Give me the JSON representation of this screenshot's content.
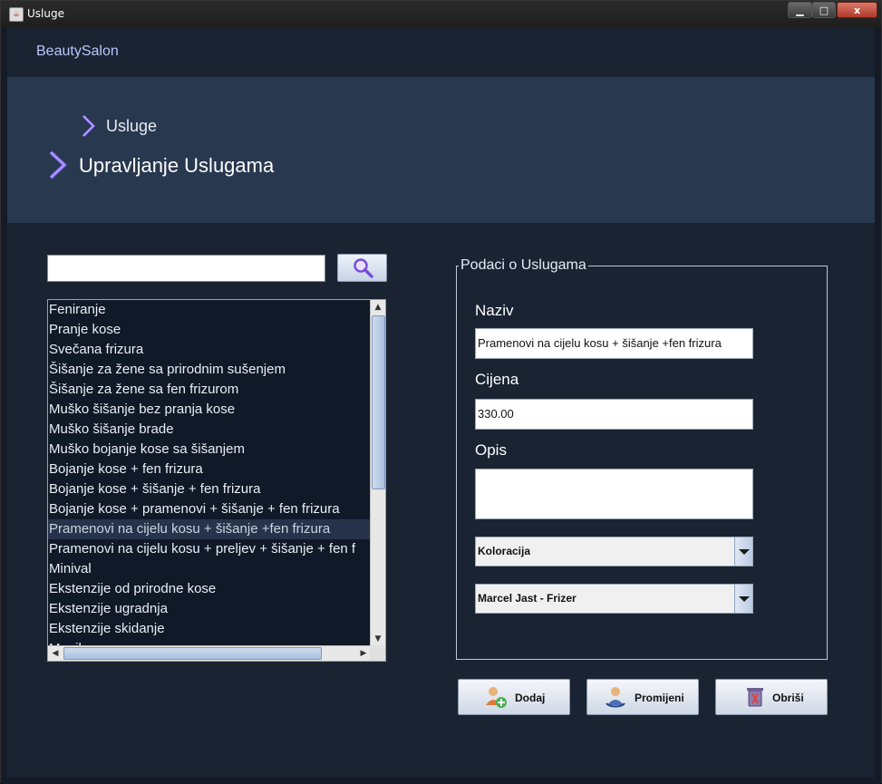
{
  "window": {
    "title": "Usluge",
    "controls": {
      "minimize": "▁",
      "maximize": "□",
      "close": "x"
    }
  },
  "header": {
    "brand": "BeautySalon"
  },
  "banner": {
    "breadcrumb": "Usluge",
    "heading": "Upravljanje Uslugama"
  },
  "search": {
    "value": "",
    "button_icon": "magnifier-icon"
  },
  "services": {
    "items": [
      "Feniranje",
      "Pranje kose",
      "Svečana frizura",
      "Šišanje za žene sa prirodnim sušenjem",
      "Šišanje za žene sa fen frizurom",
      "Muško šišanje bez pranja kose",
      "Muško šišanje brade",
      "Muško bojanje kose sa šišanjem",
      "Bojanje kose + fen frizura",
      "Bojanje kose + šišanje + fen frizura",
      "Bojanje kose + pramenovi + šišanje + fen frizura",
      "Pramenovi na cijelu kosu + šišanje +fen frizura",
      "Pramenovi na  cijelu kosu + preljev + šišanje + fen f",
      "Minival",
      "Ekstenzije od prirodne kose",
      "Ekstenzije ugradnja",
      "Ekstenzije skidanje",
      "Manikura"
    ],
    "selected_index": 11
  },
  "details": {
    "legend": "Podaci o Uslugama",
    "naziv_label": "Naziv",
    "naziv_value": "Pramenovi na cijelu kosu + šišanje +fen frizura",
    "cijena_label": "Cijena",
    "cijena_value": "330.00",
    "opis_label": "Opis",
    "opis_value": "",
    "category_selected": "Koloracija",
    "employee_selected": "Marcel Jast - Frizer"
  },
  "actions": {
    "add_label": "Dodaj",
    "edit_label": "Promijeni",
    "delete_label": "Obriši"
  },
  "colors": {
    "background": "#1a2332",
    "banner": "#28384f",
    "brand_text": "#b8c6ff",
    "chevron_accent": "#8a6bff"
  }
}
